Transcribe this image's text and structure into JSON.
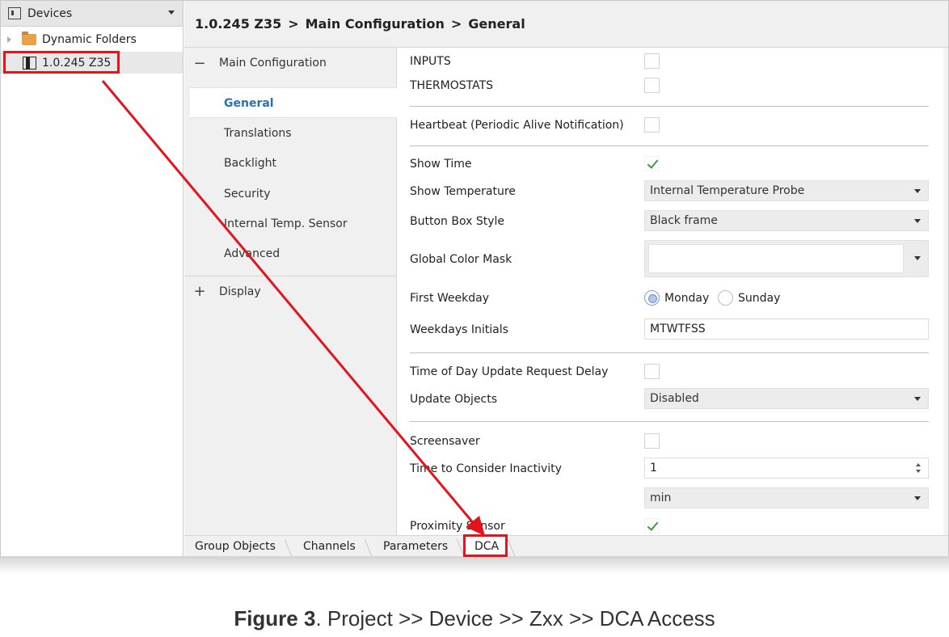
{
  "tree": {
    "header": "Devices",
    "items": [
      {
        "label": "Dynamic Folders",
        "icon": "folder-icon"
      },
      {
        "label": "1.0.245 Z35",
        "icon": "device-icon",
        "selected": true
      }
    ]
  },
  "breadcrumb": {
    "parts": [
      "1.0.245 Z35",
      "Main Configuration",
      "General"
    ],
    "separator": ">"
  },
  "nav": {
    "groups": [
      {
        "label": "Main Configuration",
        "symbol": "−",
        "expanded": true,
        "items": [
          "General",
          "Translations",
          "Backlight",
          "Security",
          "Internal Temp. Sensor",
          "Advanced"
        ],
        "active": "General"
      },
      {
        "label": "Display",
        "symbol": "+",
        "expanded": false
      }
    ]
  },
  "form": {
    "inputs": {
      "label": "INPUTS",
      "checked": false
    },
    "thermostats": {
      "label": "THERMOSTATS",
      "checked": false
    },
    "heartbeat": {
      "label": "Heartbeat (Periodic Alive Notification)",
      "checked": false
    },
    "show_time": {
      "label": "Show Time",
      "checked": true
    },
    "show_temperature": {
      "label": "Show Temperature",
      "value": "Internal Temperature Probe"
    },
    "button_box_style": {
      "label": "Button Box Style",
      "value": "Black frame"
    },
    "global_color_mask": {
      "label": "Global Color Mask",
      "value": ""
    },
    "first_weekday": {
      "label": "First Weekday",
      "options": [
        "Monday",
        "Sunday"
      ],
      "selected": "Monday"
    },
    "weekdays_initials": {
      "label": "Weekdays Initials",
      "value": "MTWTFSS"
    },
    "time_of_day": {
      "label": "Time of Day Update Request Delay",
      "checked": false
    },
    "update_objects": {
      "label": "Update Objects",
      "value": "Disabled"
    },
    "screensaver": {
      "label": "Screensaver",
      "checked": false
    },
    "inactivity": {
      "label": "Time to Consider Inactivity",
      "value": "1",
      "unit": "min"
    },
    "proximity_sensor": {
      "label": "Proximity Sensor",
      "checked": true
    }
  },
  "tabs": [
    {
      "label": "Group Objects"
    },
    {
      "label": "Channels"
    },
    {
      "label": "Parameters"
    },
    {
      "label": "DCA",
      "highlighted": true
    }
  ],
  "annotation": {
    "highlight_color": "#e3141b"
  },
  "caption": {
    "label": "Figure 3",
    "text": ". Project >> Device >> Zxx >> DCA Access"
  }
}
